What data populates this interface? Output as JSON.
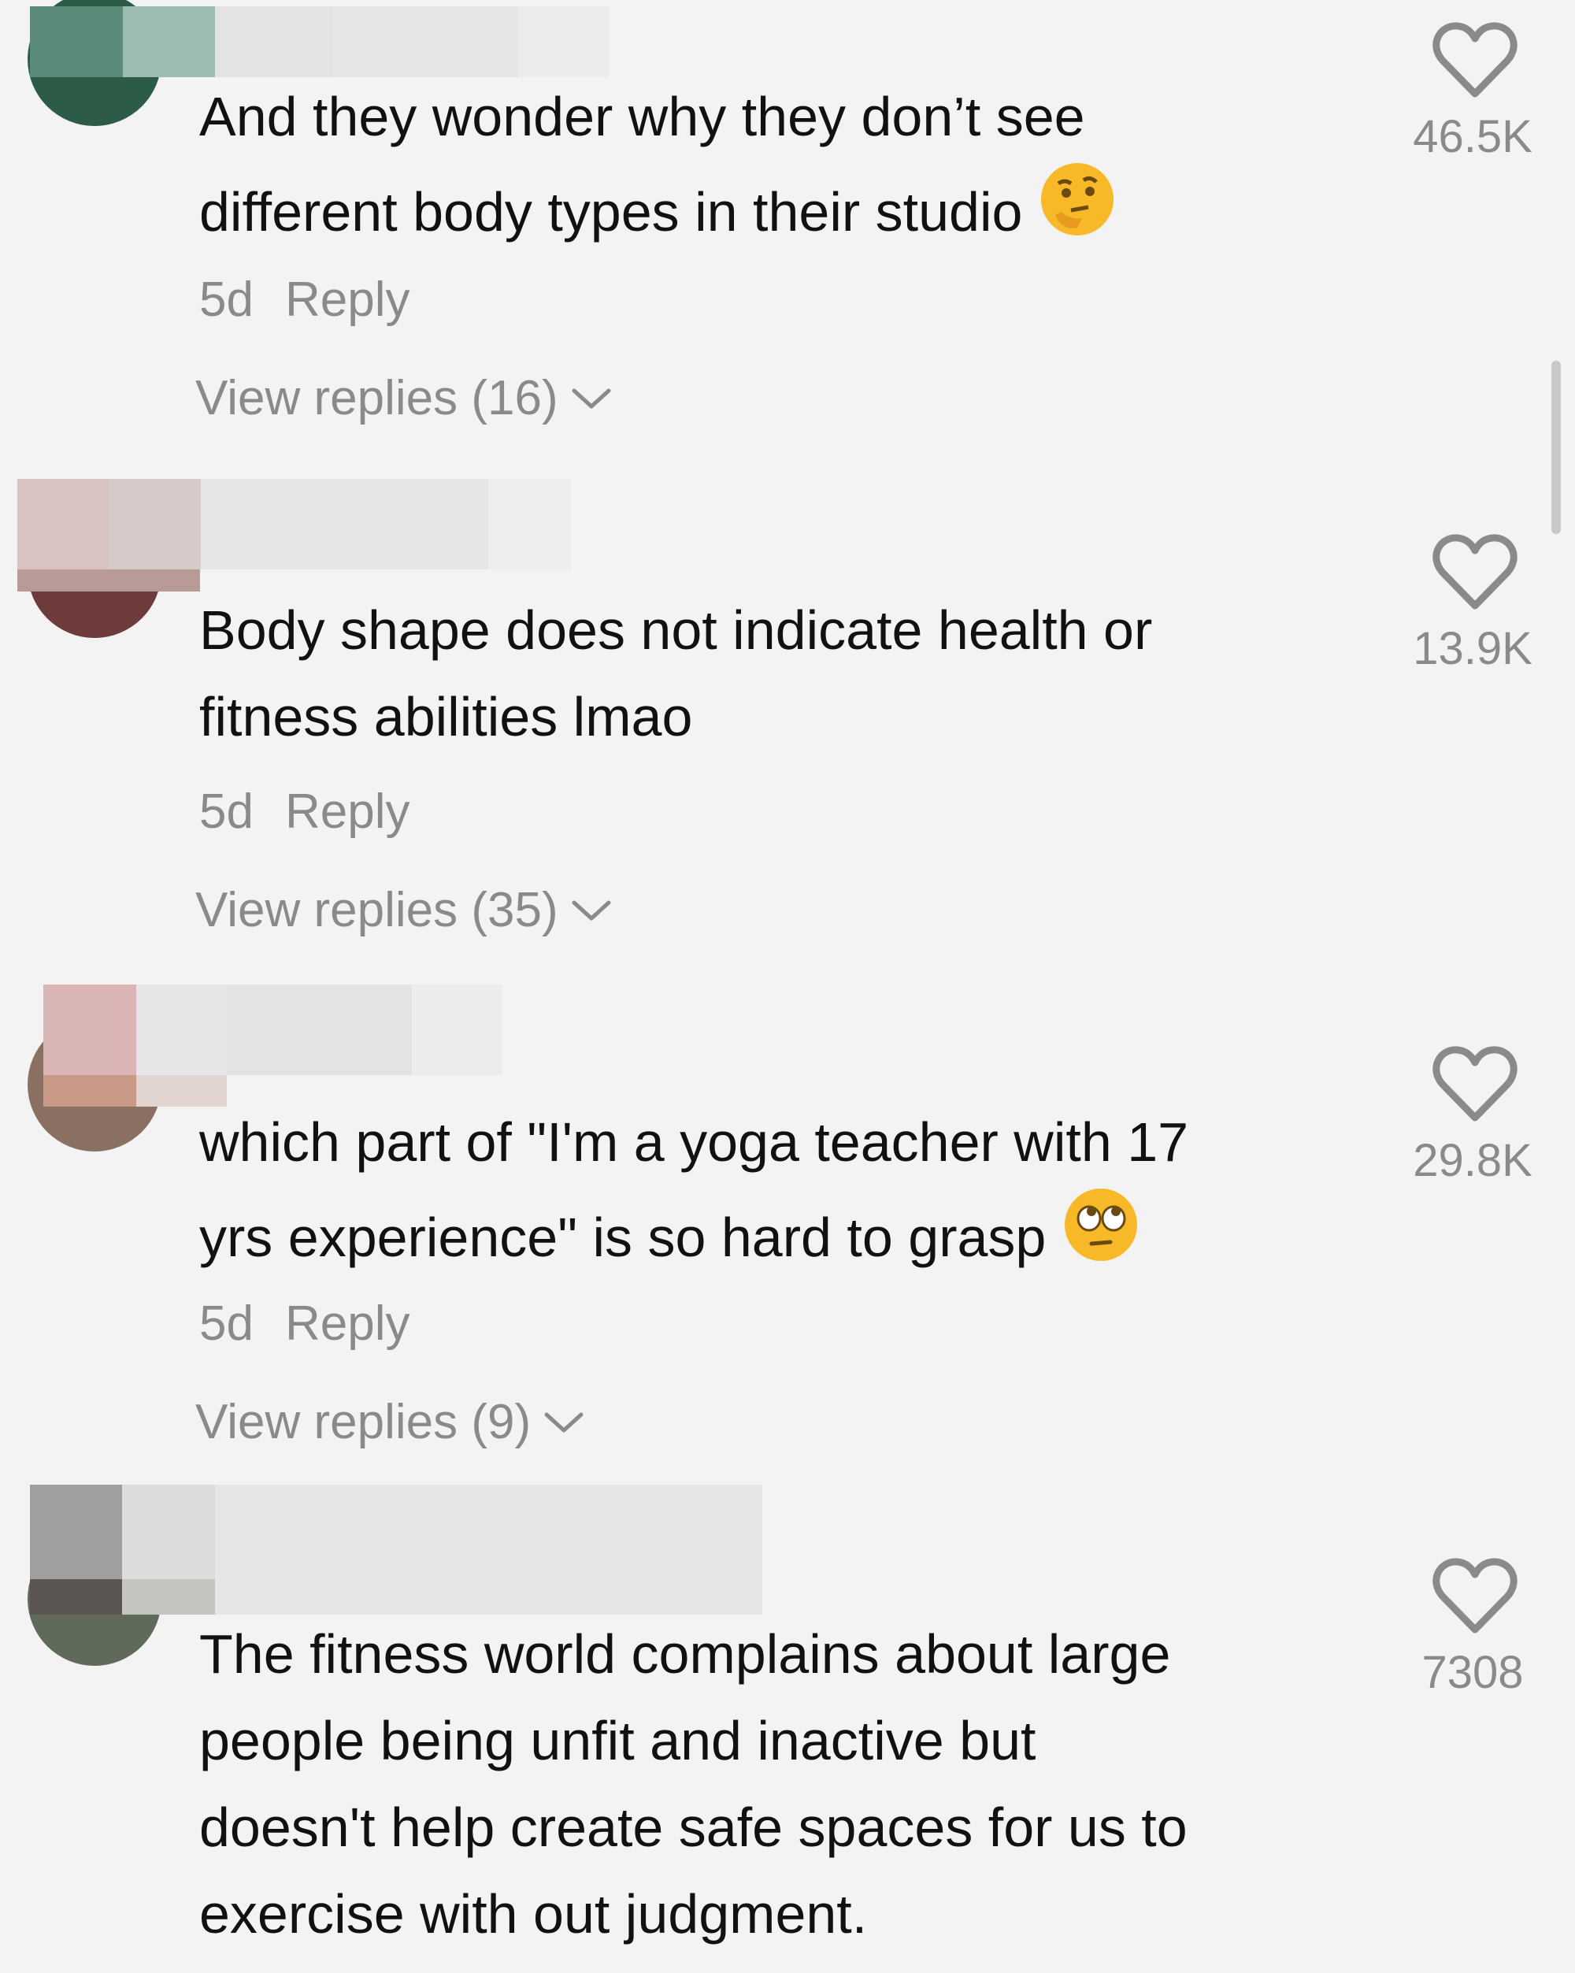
{
  "comments": [
    {
      "text_lines": [
        "And they wonder why they don’t see",
        "different body types in their studio"
      ],
      "emoji": "thinking-face-emoji",
      "age": "5d",
      "reply_label": "Reply",
      "view_replies": "View replies (16)",
      "likes": "46.5K"
    },
    {
      "text_lines": [
        "Body shape does not indicate health or",
        "fitness abilities lmao"
      ],
      "age": "5d",
      "reply_label": "Reply",
      "view_replies": "View replies (35)",
      "likes": "13.9K"
    },
    {
      "text_lines": [
        "which part of \"I'm a yoga teacher with 17",
        "yrs experience\" is so hard to grasp"
      ],
      "emoji": "eye-roll-emoji",
      "age": "5d",
      "reply_label": "Reply",
      "view_replies": "View replies (9)",
      "likes": "29.8K"
    },
    {
      "text_lines": [
        "The fitness world complains about large",
        "people being unfit and inactive but",
        "doesn't help create safe spaces for us to",
        "exercise with out judgment."
      ],
      "likes": "7308"
    }
  ],
  "colors": {
    "background": "#f3f3f3",
    "text": "#111111",
    "muted": "#8a8a8a",
    "emoji_yellow": "#f7b928"
  }
}
